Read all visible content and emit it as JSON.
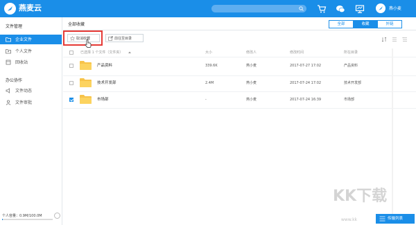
{
  "app": {
    "title": "燕麦云",
    "user_name": "燕小麦",
    "colors": {
      "brand": "#1a8ee8",
      "highlight": "#e53935"
    }
  },
  "sidebar": {
    "sections": [
      {
        "heading": "文件管理",
        "items": [
          {
            "label": "企业文件",
            "icon": "folder-icon",
            "active": true
          },
          {
            "label": "个人文件",
            "icon": "user-folder-icon",
            "active": false
          },
          {
            "label": "回收站",
            "icon": "trash-icon",
            "active": false
          }
        ]
      },
      {
        "heading": "办公协作",
        "items": [
          {
            "label": "文件动态",
            "icon": "broadcast-icon",
            "active": false
          },
          {
            "label": "文件审批",
            "icon": "approval-icon",
            "active": false
          }
        ]
      }
    ],
    "storage_text": "个人容量：0.9M/100.0M",
    "storage_fraction": 0.009
  },
  "main": {
    "breadcrumb": "全部收藏",
    "view_tabs": [
      {
        "label": "全部",
        "active": false
      },
      {
        "label": "收藏",
        "active": true
      },
      {
        "label": "外链",
        "active": false
      }
    ],
    "toolbar": {
      "cancel_favorite": "取消收藏",
      "go_to_folder": "前往至目录"
    },
    "columns": {
      "select_count": "已选择 1 个文件（文件夹）",
      "size": "大小",
      "modifier": "修改人",
      "modified_time": "修改时间",
      "location": "所在目录"
    },
    "rows": [
      {
        "name": "产品资料",
        "size": "339.6K",
        "modifier": "燕小麦",
        "time": "2017-07-27 17:02",
        "location": "产品资料",
        "checked": false
      },
      {
        "name": "技术开发部",
        "size": "2.4M",
        "modifier": "燕小麦",
        "time": "2017-07-24 17:02",
        "location": "技术开发部",
        "checked": false
      },
      {
        "name": "市场部",
        "size": "-",
        "modifier": "燕小麦",
        "time": "2017-07-24 16:39",
        "location": "市场部",
        "checked": true
      }
    ],
    "transfer_button": "传输列表"
  },
  "watermark": {
    "brand": "KK下载",
    "url": "www.kk"
  }
}
